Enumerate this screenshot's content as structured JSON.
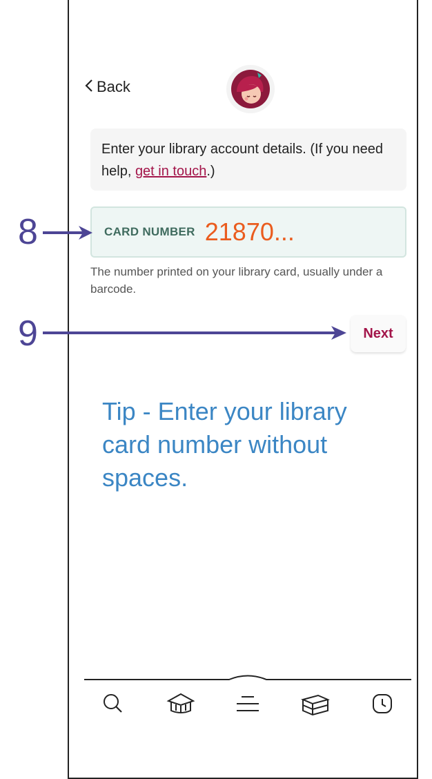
{
  "header": {
    "back_label": "Back"
  },
  "help": {
    "text_before": "Enter your library account details. (If you need help, ",
    "link_text": "get in touch",
    "text_after": ".)"
  },
  "card_field": {
    "label": "CARD NUMBER",
    "value": "21870..."
  },
  "hint": "The number printed on your library card, usually under a barcode.",
  "next_button": "Next",
  "annotations": {
    "step_8": "8",
    "step_9": "9"
  },
  "tip": "Tip - Enter your library card number without spaces.",
  "nav": {
    "icons": [
      "search-icon",
      "library-icon",
      "menu-icon",
      "books-icon",
      "clock-icon"
    ]
  },
  "colors": {
    "brand": "#a3154a",
    "value": "#ea5c1e",
    "annotation": "#4d4595",
    "tip": "#3b86c4"
  }
}
